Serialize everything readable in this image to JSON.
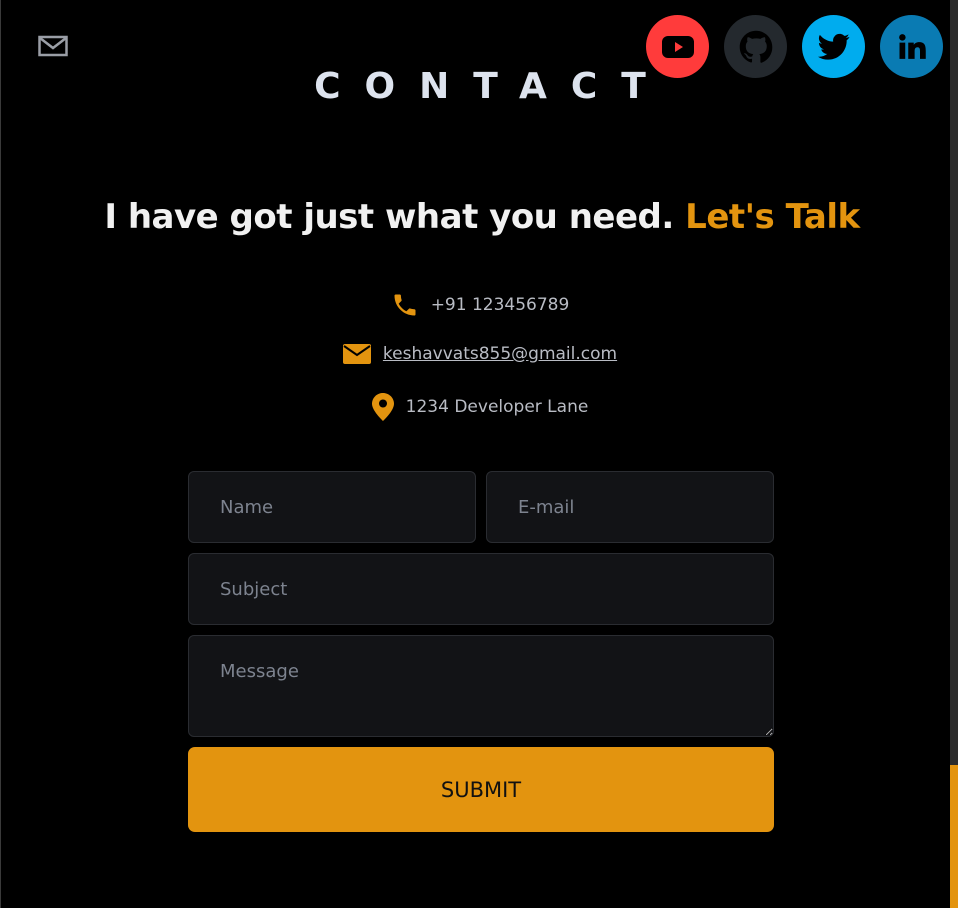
{
  "section": {
    "title": "CONTACT",
    "headline": "I have got just what you need.",
    "headline_accent": "Let's Talk"
  },
  "contact": {
    "phone": "+91 123456789",
    "email": "keshavvats855@gmail.com",
    "address": "1234 Developer Lane"
  },
  "social": [
    {
      "name": "YouTube",
      "icon": "youtube-icon",
      "color": "#ff3b3b"
    },
    {
      "name": "GitHub",
      "icon": "github-icon",
      "color": "#24292e"
    },
    {
      "name": "Twitter",
      "icon": "twitter-icon",
      "color": "#00acee"
    },
    {
      "name": "LinkedIn",
      "icon": "linkedin-icon",
      "color": "#0a7bb3"
    }
  ],
  "form": {
    "name_placeholder": "Name",
    "email_placeholder": "E-mail",
    "subject_placeholder": "Subject",
    "message_placeholder": "Message",
    "submit_label": "SUBMIT"
  },
  "colors": {
    "accent": "#e3940f",
    "background": "#000000",
    "field_background": "#121316"
  }
}
